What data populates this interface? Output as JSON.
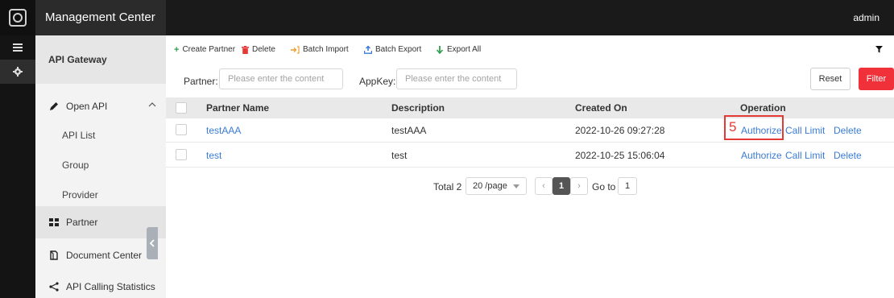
{
  "header": {
    "app_title": "Management Center",
    "user_name": "admin"
  },
  "rail": {
    "items": [
      {
        "icon": "menu-icon",
        "active": false
      },
      {
        "icon": "gear-icon",
        "active": true
      }
    ]
  },
  "sidebar": {
    "title": "API Gateway",
    "open_api": "Open API",
    "api_list": "API List",
    "group": "Group",
    "provider": "Provider",
    "partner": "Partner",
    "document_center": "Document Center",
    "api_calling_statistics": "API Calling Statistics"
  },
  "toolbar": {
    "create_partner": "Create Partner",
    "delete": "Delete",
    "batch_import": "Batch Import",
    "batch_export": "Batch Export",
    "export_all": "Export All"
  },
  "filters": {
    "partner_label": "Partner:",
    "partner_placeholder": "Please enter the content",
    "appkey_label": "AppKey:",
    "appkey_placeholder": "Please enter the content",
    "reset": "Reset",
    "filter": "Filter"
  },
  "table": {
    "columns": {
      "partner_name": "Partner Name",
      "description": "Description",
      "created_on": "Created On",
      "operation": "Operation"
    },
    "rows": [
      {
        "partner_name": "testAAA",
        "description": "testAAA",
        "created_on": "2022-10-26 09:27:28"
      },
      {
        "partner_name": "test",
        "description": "test",
        "created_on": "2022-10-25 15:06:04"
      }
    ],
    "actions": {
      "authorize": "Authorize",
      "call_limit": "Call Limit",
      "delete": "Delete"
    }
  },
  "annotation": {
    "step_number": "5"
  },
  "pagination": {
    "total": "Total 2",
    "page_size": "20 /page",
    "current_page": "1",
    "goto_label": "Go to",
    "goto_value": "1"
  },
  "colors": {
    "accent_red": "#f0313a",
    "link_blue": "#3a7bd5",
    "create_green": "#2e9e4f"
  }
}
